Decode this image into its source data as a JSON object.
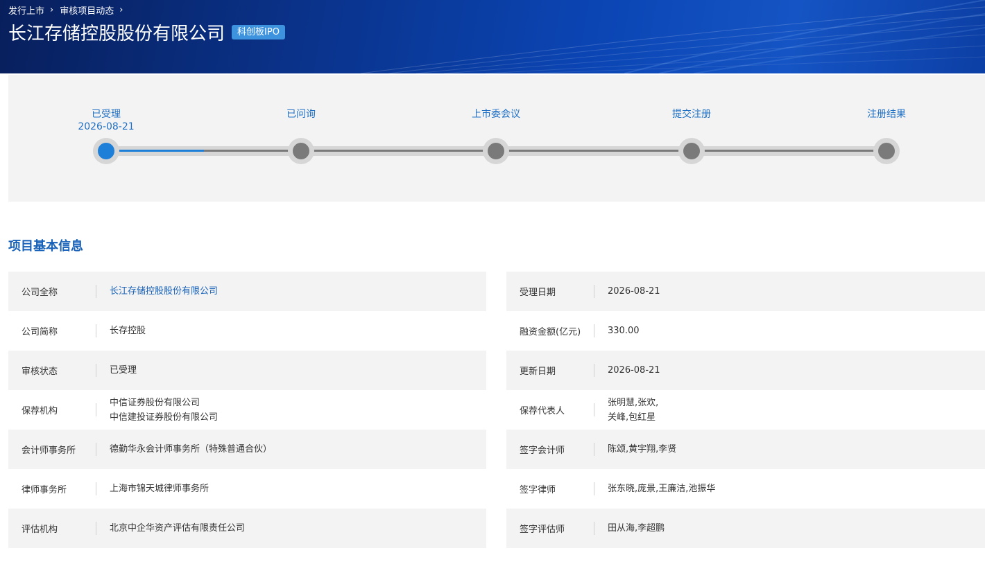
{
  "breadcrumb": [
    "发行上市",
    "审核项目动态"
  ],
  "company": {
    "title": "长江存储控股股份有限公司",
    "board_badge": "科创板IPO"
  },
  "progress": {
    "steps": [
      {
        "label": "已受理",
        "date": "2026-08-21",
        "active": true
      },
      {
        "label": "已问询",
        "date": "",
        "active": false
      },
      {
        "label": "上市委会议",
        "date": "",
        "active": false
      },
      {
        "label": "提交注册",
        "date": "",
        "active": false
      },
      {
        "label": "注册结果",
        "date": "",
        "active": false
      }
    ],
    "fill_fraction": 0.125
  },
  "section": {
    "title": "项目基本信息"
  },
  "info": {
    "rows": [
      {
        "left_label": "公司全称",
        "left_value": [
          "长江存储控股股份有限公司"
        ],
        "right_label": "受理日期",
        "right_value": [
          "2026-08-21"
        ]
      },
      {
        "left_label": "公司简称",
        "left_value": [
          "长存控股"
        ],
        "right_label": "融资金额(亿元)",
        "right_value": [
          "330.00"
        ]
      },
      {
        "left_label": "审核状态",
        "left_value": [
          "已受理"
        ],
        "right_label": "更新日期",
        "right_value": [
          "2026-08-21"
        ]
      },
      {
        "left_label": "保荐机构",
        "left_value": [
          "中信证券股份有限公司",
          "中信建投证券股份有限公司"
        ],
        "right_label": "保荐代表人",
        "right_value": [
          "张明慧,张欢,",
          "关峰,包红星"
        ]
      },
      {
        "left_label": "会计师事务所",
        "left_value": [
          "德勤华永会计师事务所（特殊普通合伙）"
        ],
        "right_label": "签字会计师",
        "right_value": [
          "陈颂,黄宇翔,李贤"
        ]
      },
      {
        "left_label": "律师事务所",
        "left_value": [
          "上海市锦天城律师事务所"
        ],
        "right_label": "签字律师",
        "right_value": [
          "张东晓,庞景,王廉洁,池振华"
        ]
      },
      {
        "left_label": "评估机构",
        "left_value": [
          "北京中企华资产评估有限责任公司"
        ],
        "right_label": "签字评估师",
        "right_value": [
          "田从海,李超鹏"
        ]
      }
    ]
  },
  "colors": {
    "accent": "#1761b8",
    "progress_active": "#1e7fd8",
    "badge": "#3e93df",
    "banner": "#0a3590"
  },
  "icons": {
    "breadcrumb_separator": "chevron-right-icon"
  }
}
